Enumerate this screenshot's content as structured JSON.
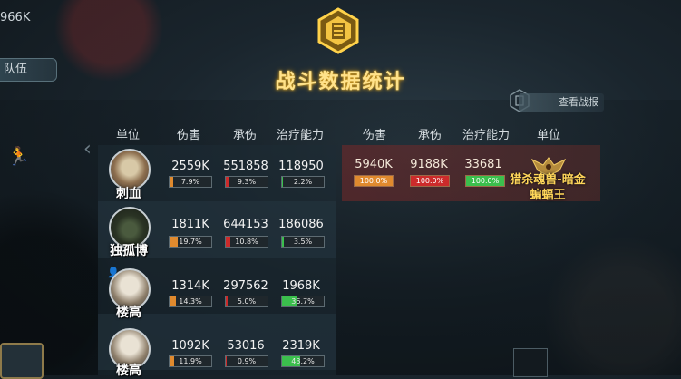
{
  "hud": {
    "top_left_count": "966K",
    "team_tab": "队伍"
  },
  "title": "战斗数据统计",
  "view_report": "查看战报",
  "columns_left": [
    "单位",
    "伤害",
    "承伤",
    "治疗能力"
  ],
  "columns_right": [
    "伤害",
    "承伤",
    "治疗能力",
    "单位"
  ],
  "heroes": [
    {
      "name": "刺血",
      "damage": "2559K",
      "damage_pct": "7.9%",
      "taken": "551858",
      "taken_pct": "9.3%",
      "heal": "118950",
      "heal_pct": "2.2%",
      "damage_fill": 0.079,
      "taken_fill": 0.093,
      "heal_fill": 0.022
    },
    {
      "name": "独孤博",
      "damage": "1811K",
      "damage_pct": "19.7%",
      "taken": "644153",
      "taken_pct": "10.8%",
      "heal": "186086",
      "heal_pct": "3.5%",
      "damage_fill": 0.197,
      "taken_fill": 0.108,
      "heal_fill": 0.035
    },
    {
      "name": "楼高",
      "damage": "1314K",
      "damage_pct": "14.3%",
      "taken": "297562",
      "taken_pct": "5.0%",
      "heal": "1968K",
      "heal_pct": "36.7%",
      "damage_fill": 0.143,
      "taken_fill": 0.05,
      "heal_fill": 0.367
    },
    {
      "name": "楼高",
      "damage": "1092K",
      "damage_pct": "11.9%",
      "taken": "53016",
      "taken_pct": "0.9%",
      "heal": "2319K",
      "heal_pct": "43.2%",
      "damage_fill": 0.119,
      "taken_fill": 0.009,
      "heal_fill": 0.432
    }
  ],
  "enemy": {
    "name": "猎杀魂兽-暗金蝙蝠王",
    "damage": "5940K",
    "damage_pct": "100.0%",
    "taken": "9188K",
    "taken_pct": "100.0%",
    "heal": "33681",
    "heal_pct": "100.0%"
  },
  "colors": {
    "damage": "#e08a2e",
    "taken": "#cc2b2b",
    "heal": "#3bbf4d",
    "title": "#ffe28a"
  }
}
